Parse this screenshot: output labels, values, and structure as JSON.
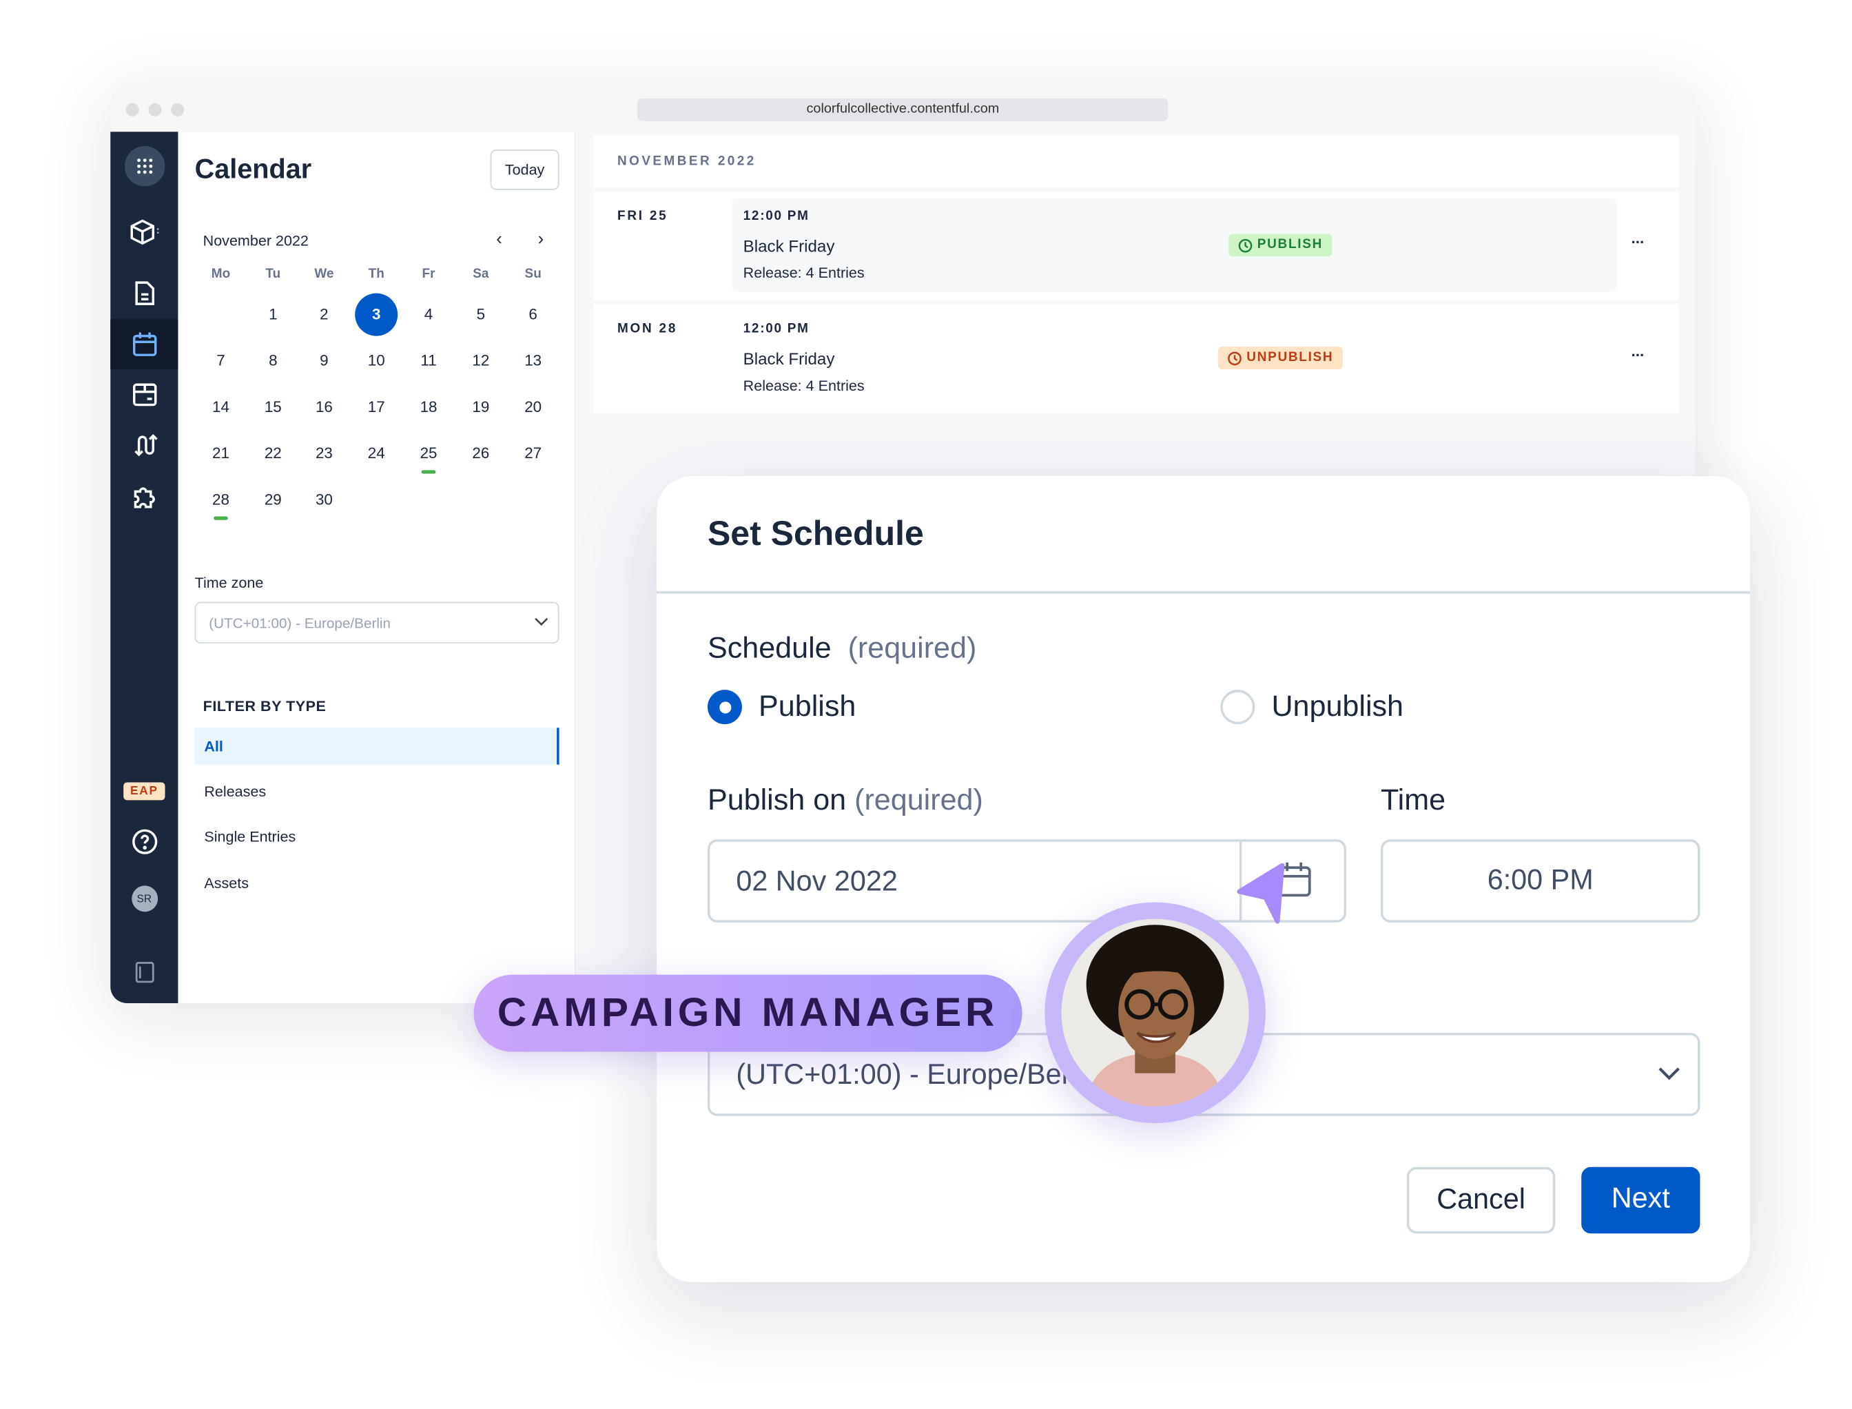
{
  "browser": {
    "url": "colorfulcollective.contentful.com"
  },
  "sidebar": {
    "icons": [
      "apps-grid-icon",
      "content-model-icon",
      "content-entries-icon",
      "calendar-icon",
      "media-icon",
      "workflow-icon",
      "apps-puzzle-icon"
    ],
    "eap_badge": "EAP",
    "avatar_initials": "SR"
  },
  "calendar": {
    "title": "Calendar",
    "today_label": "Today",
    "month_label": "November 2022",
    "weekdays": [
      "Mo",
      "Tu",
      "We",
      "Th",
      "Fr",
      "Sa",
      "Su"
    ],
    "days": [
      "1",
      "2",
      "3",
      "4",
      "5",
      "6",
      "7",
      "8",
      "9",
      "10",
      "11",
      "12",
      "13",
      "14",
      "15",
      "16",
      "17",
      "18",
      "19",
      "20",
      "21",
      "22",
      "23",
      "24",
      "25",
      "26",
      "27",
      "28",
      "29",
      "30"
    ],
    "selected_day": "3",
    "marked_days": [
      "25",
      "28"
    ],
    "timezone_label": "Time zone",
    "timezone_value": "(UTC+01:00) - Europe/Berlin",
    "filter_title": "FILTER BY TYPE",
    "filters": [
      "All",
      "Releases",
      "Single Entries",
      "Assets"
    ],
    "active_filter": "All"
  },
  "schedule_list": {
    "month_header": "NOVEMBER 2022",
    "events": [
      {
        "date": "FRI 25",
        "time": "12:00 PM",
        "title": "Black Friday",
        "subtitle": "Release: 4 Entries",
        "badge": "PUBLISH",
        "badge_color": "#1a7f37",
        "badge_bg": "#cdf3c6"
      },
      {
        "date": "MON 28",
        "time": "12:00 PM",
        "title": "Black Friday",
        "subtitle": "Release: 4 Entries",
        "badge": "UNPUBLISH",
        "badge_color": "#bf3b14",
        "badge_bg": "#ffe3c2"
      }
    ],
    "more_label": "..."
  },
  "modal": {
    "title": "Set Schedule",
    "schedule_label": "Schedule",
    "required": "(required)",
    "options": [
      "Publish",
      "Unpublish"
    ],
    "selected_option": "Publish",
    "publish_on_label": "Publish on",
    "date_value": "02 Nov 2022",
    "time_label": "Time",
    "time_value": "6:00 PM",
    "timezone_value": "(UTC+01:00) - Europe/Berlin",
    "cancel_label": "Cancel",
    "next_label": "Next",
    "accent": "#0059c8"
  },
  "overlay": {
    "role_badge": "CAMPAIGN MANAGER"
  }
}
